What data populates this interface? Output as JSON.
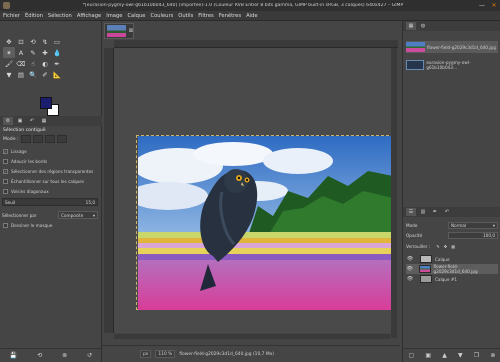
{
  "window": {
    "title": "*[eurasion-pygmy-owl-g61b10b043_640] (importée)-1.0 (Couleur RVB Entier 8 bits gamma, GIMP built-in sRGB, 3 calques) 640x427 – GIMP",
    "minimize": "—",
    "close": "✕"
  },
  "menu": [
    "Fichier",
    "Édition",
    "Sélection",
    "Affichage",
    "Image",
    "Calque",
    "Couleurs",
    "Outils",
    "Filtres",
    "Fenêtres",
    "Aide"
  ],
  "toolbox": {
    "tools": [
      "move-icon",
      "crop-icon",
      "rotate-icon",
      "warp-icon",
      "rect-select-icon",
      "fuzzy-select-icon",
      "text-icon",
      "clone-icon",
      "heal-icon",
      "blur-icon",
      "paint-icon",
      "eraser-icon",
      "smudge-icon",
      "dodge-icon",
      "path-icon",
      "bucket-icon",
      "gradient-icon",
      "zoom-icon",
      "eyedrop-icon",
      "measure-icon"
    ],
    "tool_glyphs": [
      "✥",
      "⊡",
      "⟲",
      "↯",
      "▭",
      "✶",
      "A",
      "✎",
      "✚",
      "💧",
      "🖌",
      "⌫",
      "☝",
      "◐",
      "✒",
      "▼",
      "▤",
      "🔍",
      "✐",
      "📐"
    ],
    "fg_color": "#1b1d6e",
    "bg_color": "#ffffff"
  },
  "tool_options": {
    "title": "Sélection contiguë",
    "mode_label": "Mode :",
    "antialias": "Lissage",
    "feather": "Adoucir les bords",
    "transparent": "Sélectionner des régions transparentes",
    "sample_merged": "Échantillonner sur tous les calques",
    "diagonal": "Voisins diagonaux",
    "threshold_label": "Seuil",
    "threshold_value": "15,0",
    "select_by_label": "Sélectionner par",
    "select_by_value": "Composite",
    "draw_mask": "Dessiner le masque"
  },
  "image_tabs": {
    "close": "⊠"
  },
  "status": {
    "unit": "px",
    "zoom": "110 %",
    "info": "flower-field-g2029c3d1d_640.jpg (10,7 Mo)"
  },
  "images_panel": {
    "items": [
      {
        "label": "flower-field-g2029c3d1d_640.jpg"
      },
      {
        "label": "eurasion-pygmy-owl-g61b10b043..."
      }
    ]
  },
  "layers_panel": {
    "mode_label": "Mode",
    "mode_value": "Normal",
    "opacity_label": "Opacité",
    "opacity_value": "100,0",
    "lock_label": "Verrouiller :",
    "layers": [
      {
        "name": "Calque",
        "selected": false
      },
      {
        "name": "flower-field-g2029c3d1d_640.jpg",
        "selected": true
      },
      {
        "name": "Calque #1",
        "selected": false
      }
    ]
  }
}
